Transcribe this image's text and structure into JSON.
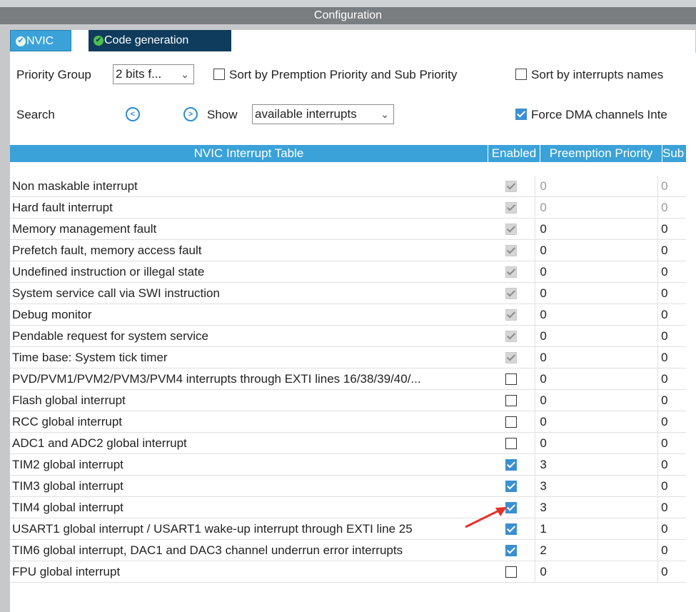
{
  "window": {
    "title": "Configuration"
  },
  "tabs": [
    {
      "label": "NVIC"
    },
    {
      "label": "Code generation"
    }
  ],
  "toolbar": {
    "priority_group_label": "Priority Group",
    "priority_group_value": "2 bits f...",
    "sort_premption_label": "Sort by Premption Priority and Sub Priority",
    "sort_names_label": "Sort by interrupts names",
    "search_label": "Search",
    "show_label": "Show",
    "show_value": "available interrupts",
    "force_dma_label": "Force DMA channels Inte",
    "force_dma_checked": true
  },
  "table": {
    "headers": {
      "name": "NVIC Interrupt Table",
      "enabled": "Enabled",
      "preemption": "Preemption Priority",
      "sub": "Sub"
    },
    "rows": [
      {
        "name": "Non maskable interrupt",
        "enabled": "disabled-checked",
        "preemption": "0",
        "sub": "0",
        "greyed": true
      },
      {
        "name": "Hard fault interrupt",
        "enabled": "disabled-checked",
        "preemption": "0",
        "sub": "0",
        "greyed": true
      },
      {
        "name": "Memory management fault",
        "enabled": "disabled-checked",
        "preemption": "0",
        "sub": "0",
        "greyed": false
      },
      {
        "name": "Prefetch fault, memory access fault",
        "enabled": "disabled-checked",
        "preemption": "0",
        "sub": "0",
        "greyed": false
      },
      {
        "name": "Undefined instruction or illegal state",
        "enabled": "disabled-checked",
        "preemption": "0",
        "sub": "0",
        "greyed": false
      },
      {
        "name": "System service call via SWI instruction",
        "enabled": "disabled-checked",
        "preemption": "0",
        "sub": "0",
        "greyed": false
      },
      {
        "name": "Debug monitor",
        "enabled": "disabled-checked",
        "preemption": "0",
        "sub": "0",
        "greyed": false
      },
      {
        "name": "Pendable request for system service",
        "enabled": "disabled-checked",
        "preemption": "0",
        "sub": "0",
        "greyed": false
      },
      {
        "name": "Time base: System tick timer",
        "enabled": "disabled-checked",
        "preemption": "0",
        "sub": "0",
        "greyed": false
      },
      {
        "name": "PVD/PVM1/PVM2/PVM3/PVM4 interrupts through EXTI lines 16/38/39/40/...",
        "enabled": "unchecked",
        "preemption": "0",
        "sub": "0",
        "greyed": false
      },
      {
        "name": "Flash global interrupt",
        "enabled": "unchecked",
        "preemption": "0",
        "sub": "0",
        "greyed": false
      },
      {
        "name": "RCC global interrupt",
        "enabled": "unchecked",
        "preemption": "0",
        "sub": "0",
        "greyed": false
      },
      {
        "name": "ADC1 and ADC2 global interrupt",
        "enabled": "unchecked",
        "preemption": "0",
        "sub": "0",
        "greyed": false
      },
      {
        "name": "TIM2 global interrupt",
        "enabled": "checked",
        "preemption": "3",
        "sub": "0",
        "greyed": false
      },
      {
        "name": "TIM3 global interrupt",
        "enabled": "checked",
        "preemption": "3",
        "sub": "0",
        "greyed": false
      },
      {
        "name": "TIM4 global interrupt",
        "enabled": "checked",
        "preemption": "3",
        "sub": "0",
        "greyed": false
      },
      {
        "name": "USART1 global interrupt / USART1 wake-up interrupt through EXTI line 25",
        "enabled": "checked",
        "preemption": "1",
        "sub": "0",
        "greyed": false
      },
      {
        "name": "TIM6 global interrupt, DAC1 and DAC3 channel underrun error interrupts",
        "enabled": "checked",
        "preemption": "2",
        "sub": "0",
        "greyed": false
      },
      {
        "name": "FPU global interrupt",
        "enabled": "unchecked",
        "preemption": "0",
        "sub": "0",
        "greyed": false
      }
    ]
  },
  "annotation": {
    "arrow_color": "#e8302a",
    "icon": "red-arrow-icon"
  }
}
